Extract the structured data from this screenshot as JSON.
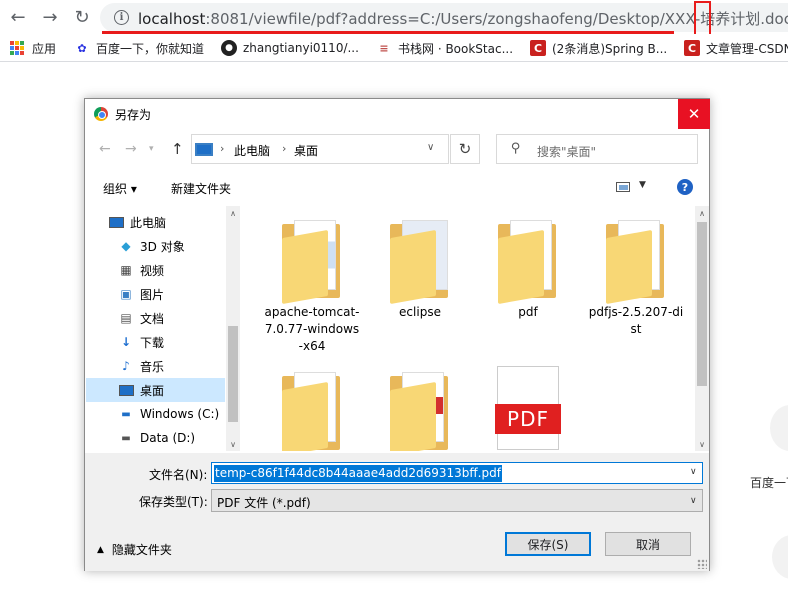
{
  "browser": {
    "url_prefix": "localhost",
    "url_rest": ":8081/viewfile/pdf?address=C:/Users/zongshaofeng/Desktop/XXX-培养计划.doc",
    "back_icon": "back-arrow-icon",
    "forward_icon": "forward-arrow-icon",
    "reload_icon": "reload-icon",
    "highlight_color": "#e81b1b"
  },
  "bookmarks": [
    {
      "label": "应用",
      "icon": "apps-grid-icon"
    },
    {
      "label": "百度一下，你就知道",
      "icon": "baidu-paw-icon"
    },
    {
      "label": "zhangtianyi0110/...",
      "icon": "github-icon"
    },
    {
      "label": "书栈网 · BookStac...",
      "icon": "bookstack-icon"
    },
    {
      "label": "(2条消息)Spring B...",
      "icon": "csdn-icon"
    },
    {
      "label": "文章管理-CSDN",
      "icon": "csdn-icon"
    }
  ],
  "page_side": {
    "text": "百度一下"
  },
  "dialog": {
    "title": "另存为",
    "close_glyph": "✕",
    "breadcrumb": [
      "此电脑",
      "桌面"
    ],
    "search_placeholder": "搜索\"桌面\"",
    "organize_label": "组织 ▾",
    "new_folder_label": "新建文件夹",
    "help_glyph": "?",
    "nav_items": [
      {
        "label": "此电脑",
        "icon": "this-pc-icon"
      },
      {
        "label": "3D 对象",
        "icon": "3d-objects-icon"
      },
      {
        "label": "视频",
        "icon": "video-icon"
      },
      {
        "label": "图片",
        "icon": "pictures-icon"
      },
      {
        "label": "文档",
        "icon": "documents-icon"
      },
      {
        "label": "下载",
        "icon": "downloads-icon"
      },
      {
        "label": "音乐",
        "icon": "music-icon"
      },
      {
        "label": "桌面",
        "icon": "desktop-icon",
        "selected": true
      },
      {
        "label": "Windows (C:)",
        "icon": "windows-drive-icon"
      },
      {
        "label": "Data (D:)",
        "icon": "drive-icon"
      }
    ],
    "files": [
      {
        "name": "apache-tomcat-7.0.77-windows-x64",
        "type": "folder"
      },
      {
        "name": "eclipse",
        "type": "folder"
      },
      {
        "name": "pdf",
        "type": "folder"
      },
      {
        "name": "pdfjs-2.5.207-dist",
        "type": "folder"
      },
      {
        "name": "",
        "type": "folder"
      },
      {
        "name": "",
        "type": "folder"
      },
      {
        "name": "",
        "type": "pdf",
        "badge": "PDF"
      }
    ],
    "filename_label": "文件名(N):",
    "filename_value": "temp-c86f1f44dc8b44aaae4add2d69313bff.pdf",
    "filetype_label": "保存类型(T):",
    "filetype_value": "PDF 文件 (*.pdf)",
    "hide_folders_label": "隐藏文件夹",
    "save_label": "保存(S)",
    "cancel_label": "取消"
  }
}
